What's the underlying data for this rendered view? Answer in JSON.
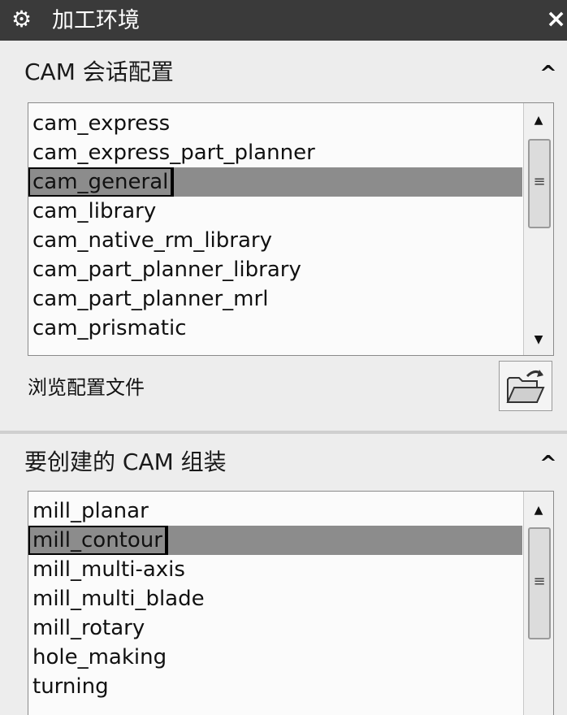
{
  "window": {
    "title": "加工环境",
    "gear_icon": "gear-icon",
    "close_glyph": "×"
  },
  "session_config": {
    "header": "CAM 会话配置",
    "collapse_glyph": "^",
    "items": [
      "cam_express",
      "cam_express_part_planner",
      "cam_general",
      "cam_library",
      "cam_native_rm_library",
      "cam_part_planner_library",
      "cam_part_planner_mrl",
      "cam_prismatic"
    ],
    "selected": "cam_general",
    "browse_label": "浏览配置文件"
  },
  "setup": {
    "header": "要创建的 CAM 组装",
    "collapse_glyph": "^",
    "items": [
      "mill_planar",
      "mill_contour",
      "mill_multi-axis",
      "mill_multi_blade",
      "mill_rotary",
      "hole_making",
      "turning"
    ],
    "selected": "mill_contour"
  },
  "colors": {
    "titlebar": "#3a3a3a",
    "selected_row": "#8c8c8c",
    "panel": "#ededed"
  }
}
